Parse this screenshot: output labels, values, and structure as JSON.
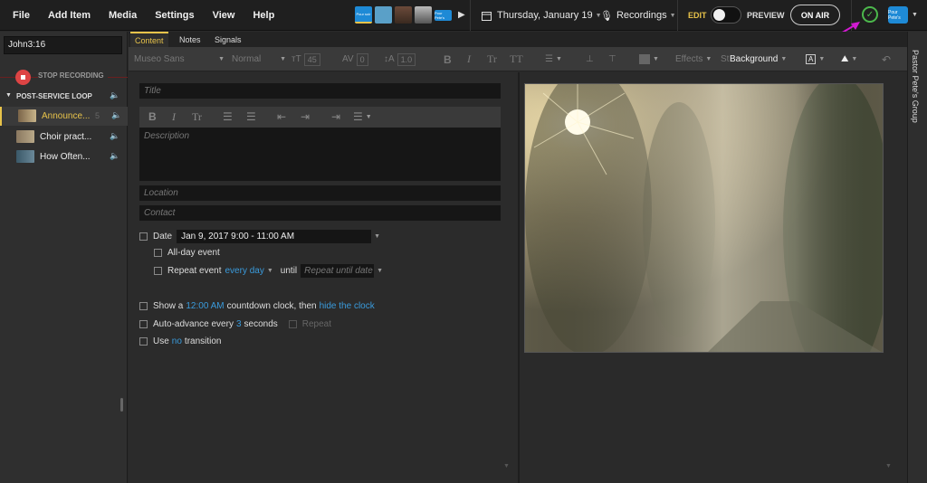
{
  "menu": {
    "items": [
      "File",
      "Add Item",
      "Media",
      "Settings",
      "View",
      "Help"
    ]
  },
  "header": {
    "thumb_labels": [
      "Pour soir",
      "Pour Pete's"
    ],
    "date": "Thursday, January 19",
    "recordings": "Recordings",
    "edit": "EDIT",
    "preview": "PREVIEW",
    "on_air": "ON AIR",
    "avatar_text": "Pour Pete's"
  },
  "left": {
    "reference": "John3:16",
    "stop_recording": "STOP RECORDING",
    "loop_name": "POST-SERVICE LOOP",
    "items": [
      {
        "name": "Announce...",
        "count": "5"
      },
      {
        "name": "Choir pract...",
        "count": ""
      },
      {
        "name": "How Often...",
        "count": ""
      }
    ]
  },
  "tabs": [
    "Content",
    "Notes",
    "Signals"
  ],
  "toolbar": {
    "font": "Museo Sans",
    "weight": "Normal",
    "size": "45",
    "spacing": "0",
    "line_height": "1.0",
    "effects": "Effects",
    "styles": "St",
    "background": "Background"
  },
  "form": {
    "title_placeholder": "Title",
    "description_placeholder": "Description",
    "location_placeholder": "Location",
    "contact_placeholder": "Contact",
    "date_label": "Date",
    "date_value": "Jan 9, 2017 9:00 - 11:00 AM",
    "all_day": "All-day event",
    "repeat_label": "Repeat event",
    "repeat_value": "every day",
    "until": "until",
    "until_placeholder": "Repeat until date",
    "countdown_pre": "Show a",
    "countdown_time": "12:00 AM",
    "countdown_mid": "countdown clock, then",
    "countdown_action": "hide the clock",
    "advance_pre": "Auto-advance every",
    "advance_num": "3",
    "advance_post": "seconds",
    "repeat2": "Repeat",
    "transition_pre": "Use",
    "transition_val": "no",
    "transition_post": "transition"
  },
  "rail": {
    "group": "Pastor Pete's Group"
  },
  "colors": {
    "accent": "#e8c34a",
    "link": "#3a9bdc",
    "arrow": "#d21ad2",
    "ok": "#4cb84c"
  }
}
